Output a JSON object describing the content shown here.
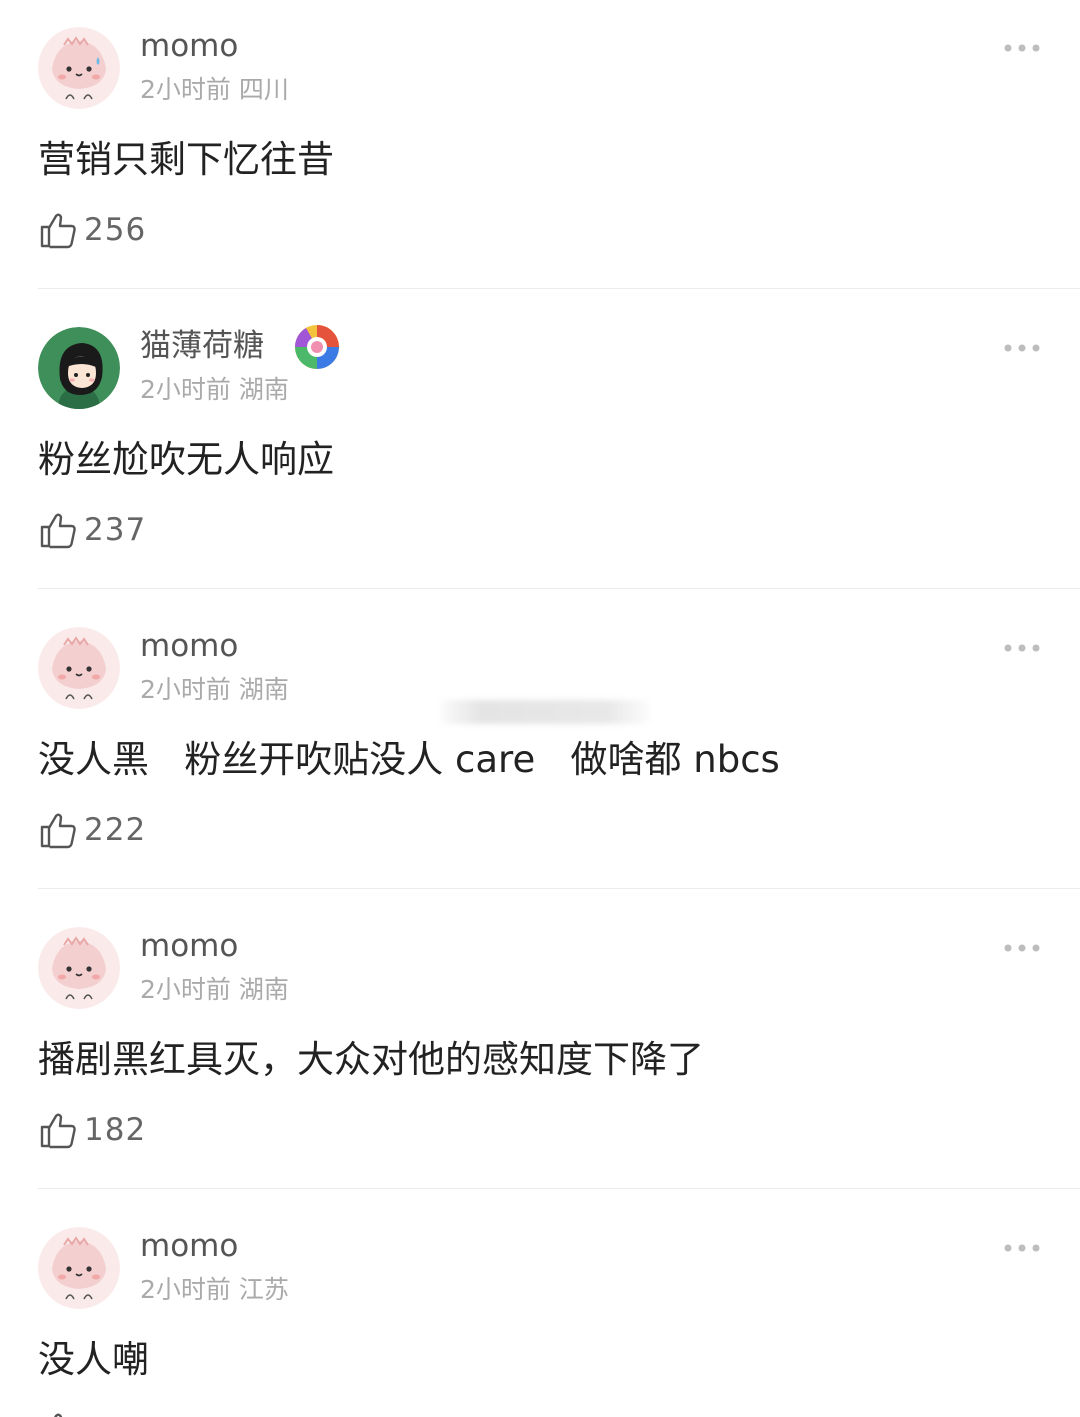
{
  "comments": [
    {
      "username": "momo",
      "time": "2小时前",
      "location": "四川",
      "text": "营销只剩下忆往昔",
      "likes": "256"
    },
    {
      "username": "猫薄荷糖",
      "time": "2小时前",
      "location": "湖南",
      "text": "粉丝尬吹无人响应",
      "likes": "237"
    },
    {
      "username": "momo",
      "time": "2小时前",
      "location": "湖南",
      "text": "没人黑   粉丝开吹贴没人 care   做啥都 nbcs",
      "likes": "222"
    },
    {
      "username": "momo",
      "time": "2小时前",
      "location": "湖南",
      "text": "播剧黑红具灭，大众对他的感知度下降了",
      "likes": "182"
    },
    {
      "username": "momo",
      "time": "2小时前",
      "location": "江苏",
      "text": "没人嘲",
      "likes": ""
    }
  ],
  "icons": {
    "like": "thumbs-up-outline-icon",
    "more": "ellipsis-icon",
    "badge": "colorful-badge-icon"
  },
  "colors": {
    "username": "#555555",
    "meta": "#aaaaaa",
    "text": "#222222",
    "avatar_pink": "#f6dcdc"
  }
}
